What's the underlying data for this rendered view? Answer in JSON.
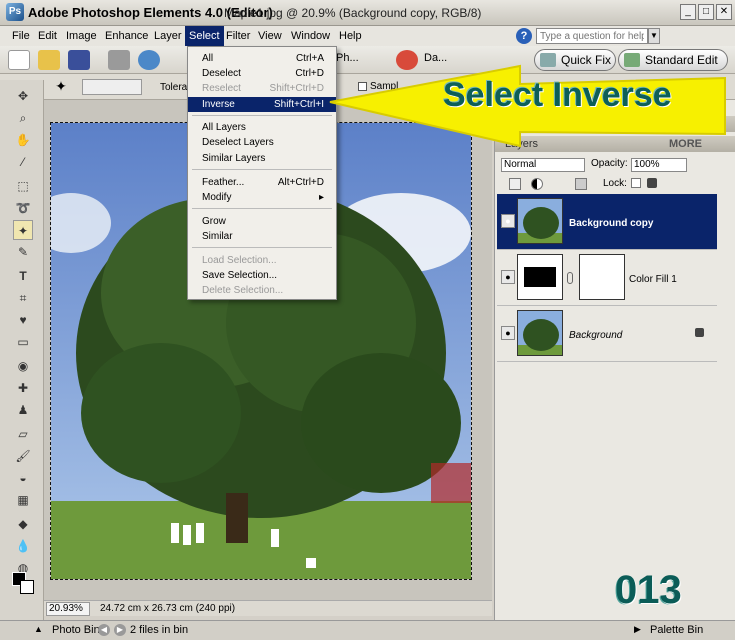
{
  "window": {
    "app_title": "Adobe Photoshop Elements 4.0 (Editor)",
    "doc_title": "Maple1.jpg @ 20.9% (Background copy, RGB/8)"
  },
  "menubar": {
    "items": [
      "File",
      "Edit",
      "Image",
      "Enhance",
      "Layer",
      "Select",
      "Filter",
      "View",
      "Window",
      "Help"
    ],
    "help_placeholder": "Type a question for help"
  },
  "shortcuts": {
    "photo_label": "Ph...",
    "date_label": "Da...",
    "quick_fix": "Quick Fix",
    "standard_edit": "Standard Edit"
  },
  "options": {
    "tolerance_label": "Toleran",
    "sample_label": "Sampl"
  },
  "select_menu": {
    "items": [
      {
        "label": "All",
        "shortcut": "Ctrl+A"
      },
      {
        "label": "Deselect",
        "shortcut": "Ctrl+D"
      },
      {
        "label": "Reselect",
        "shortcut": "Shift+Ctrl+D"
      },
      {
        "label": "Inverse",
        "shortcut": "Shift+Ctrl+I"
      },
      {
        "label": "All Layers",
        "shortcut": ""
      },
      {
        "label": "Deselect Layers",
        "shortcut": ""
      },
      {
        "label": "Similar Layers",
        "shortcut": ""
      },
      {
        "label": "Feather...",
        "shortcut": "Alt+Ctrl+D"
      },
      {
        "label": "Modify",
        "shortcut": "▸"
      },
      {
        "label": "Grow",
        "shortcut": ""
      },
      {
        "label": "Similar",
        "shortcut": ""
      },
      {
        "label": "Load Selection...",
        "shortcut": ""
      },
      {
        "label": "Save Selection...",
        "shortcut": ""
      },
      {
        "label": "Delete Selection...",
        "shortcut": ""
      }
    ]
  },
  "callout": {
    "text": "Select Inverse"
  },
  "layers_panel": {
    "title": "Layers",
    "more": "MORE",
    "blend_mode": "Normal",
    "opacity_label": "Opacity:",
    "opacity_value": "100%",
    "lock_label": "Lock:",
    "layers": [
      {
        "name": "Background copy"
      },
      {
        "name": "Color Fill 1"
      },
      {
        "name": "Background"
      }
    ]
  },
  "status": {
    "zoom": "20.93%",
    "dimensions": "24.72 cm x 26.73 cm (240 ppi)"
  },
  "photobin": {
    "label": "Photo Bin",
    "files": "2 files in bin",
    "palette": "Palette Bin"
  },
  "corner_number": "013",
  "colors": {
    "menu_highlight": "#0a246a",
    "callout_yellow": "#f7f000",
    "callout_text": "#0d5f57"
  }
}
